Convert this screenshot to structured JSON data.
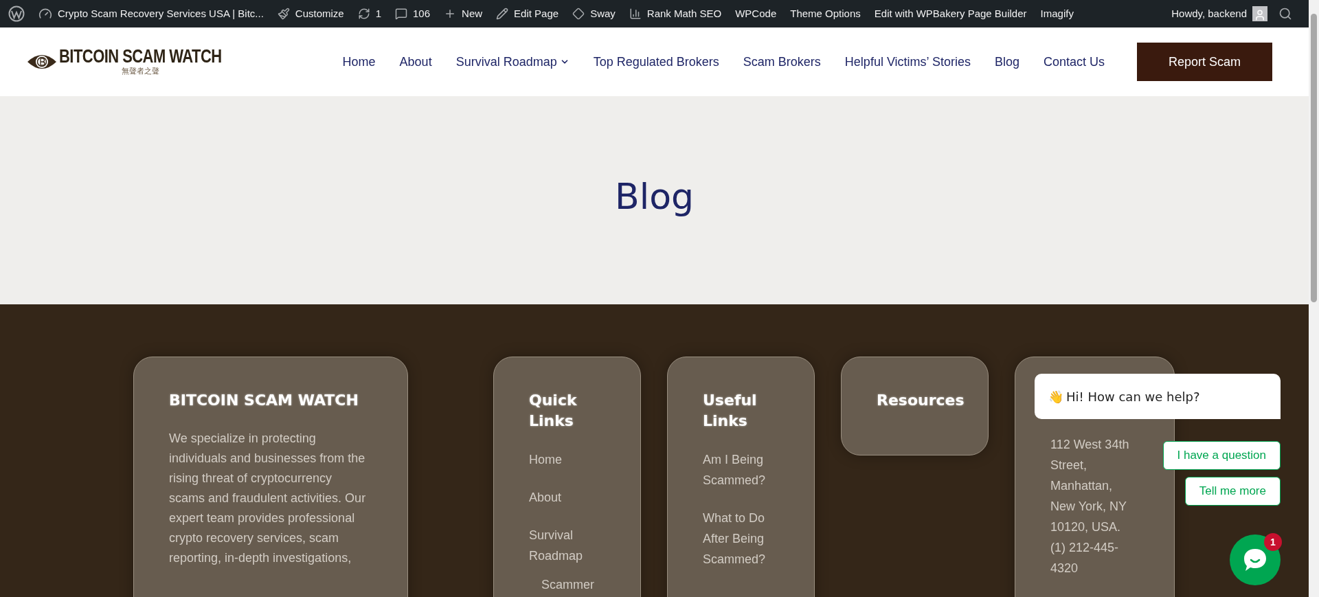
{
  "admin_bar": {
    "site_title": "Crypto Scam Recovery Services USA | Bitc...",
    "items": [
      {
        "kind": "customize",
        "label": "Customize"
      },
      {
        "kind": "updates",
        "label": "1"
      },
      {
        "kind": "comments",
        "label": "106"
      },
      {
        "kind": "new",
        "label": "New"
      },
      {
        "kind": "edit",
        "label": "Edit Page"
      },
      {
        "kind": "sway",
        "label": "Sway"
      },
      {
        "kind": "rankmath",
        "label": "Rank Math SEO"
      },
      {
        "kind": "plain",
        "label": "WPCode"
      },
      {
        "kind": "plain",
        "label": "Theme Options"
      },
      {
        "kind": "plain",
        "label": "Edit with WPBakery Page Builder"
      },
      {
        "kind": "plain",
        "label": "Imagify"
      }
    ],
    "greeting": "Howdy, backend"
  },
  "header": {
    "logo": {
      "name": "BITCOIN SCAM WATCH",
      "tagline": "無聲者之聲"
    },
    "nav": [
      {
        "label": "Home",
        "dropdown": false
      },
      {
        "label": "About",
        "dropdown": false
      },
      {
        "label": "Survival Roadmap",
        "dropdown": true
      },
      {
        "label": "Top Regulated Brokers",
        "dropdown": false
      },
      {
        "label": "Scam Brokers",
        "dropdown": false
      },
      {
        "label": "Helpful Victims’ Stories",
        "dropdown": false
      },
      {
        "label": "Blog",
        "dropdown": false
      },
      {
        "label": "Contact Us",
        "dropdown": false
      }
    ],
    "cta": "Report Scam"
  },
  "hero": {
    "title": "Blog"
  },
  "footer": {
    "about": {
      "title": "BITCOIN SCAM WATCH",
      "text": "We specialize in protecting individuals and businesses from the rising threat of cryptocurrency scams and fraudulent activities. Our expert team provides professional crypto recovery services, scam reporting, in-depth investigations,"
    },
    "columns": [
      {
        "title": "Quick Links",
        "links": [
          {
            "label": "Home"
          },
          {
            "label": "About"
          },
          {
            "label": "Survival Roadmap",
            "children": [
              {
                "label": "Scammer"
              }
            ]
          }
        ]
      },
      {
        "title": "Useful Links",
        "links": [
          {
            "label": "Am I Being Scammed?"
          },
          {
            "label": "What to Do After Being Scammed?"
          }
        ]
      },
      {
        "title": "Resources"
      }
    ],
    "contact": {
      "lines": [
        "112 West 34th Street, Manhattan, New York, NY 10120, USA.",
        "(1) 212-445-4320"
      ]
    }
  },
  "chat": {
    "wave": "👋",
    "greeting": "Hi! How can we help?",
    "options": [
      "I have a question",
      "Tell me more"
    ],
    "badge": "1"
  }
}
